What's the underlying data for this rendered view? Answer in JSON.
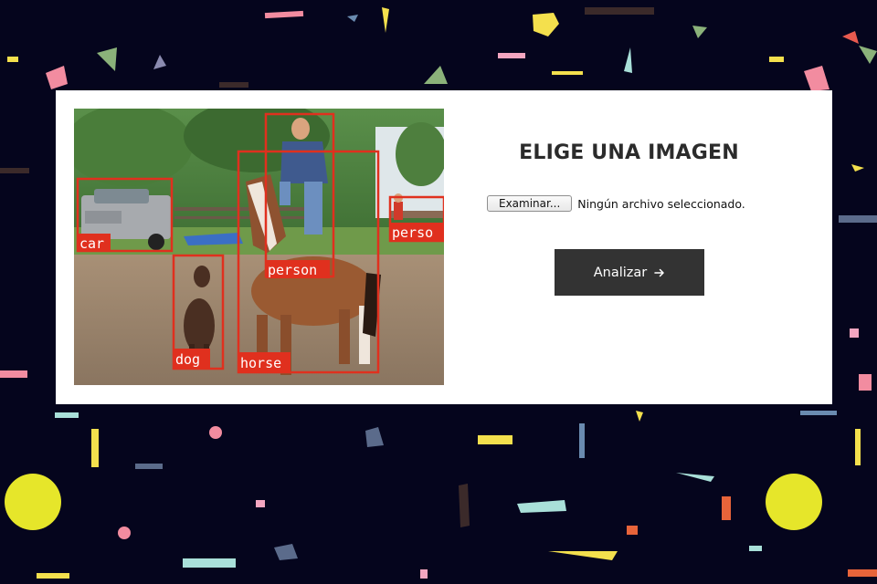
{
  "title": "ELIGE UNA IMAGEN",
  "file_input": {
    "button_label": "Examinar...",
    "status_text": "Ningún archivo seleccionado."
  },
  "analyze_button": {
    "label": "Analizar",
    "icon": "arrow-right-icon"
  },
  "detections": [
    {
      "label": "car"
    },
    {
      "label": "dog"
    },
    {
      "label": "horse"
    },
    {
      "label": "person"
    },
    {
      "label": "perso"
    }
  ],
  "colors": {
    "background": "#05051d",
    "card": "#ffffff",
    "button": "#333333",
    "detection_box": "#e0301e",
    "title": "#2b2b2b"
  }
}
